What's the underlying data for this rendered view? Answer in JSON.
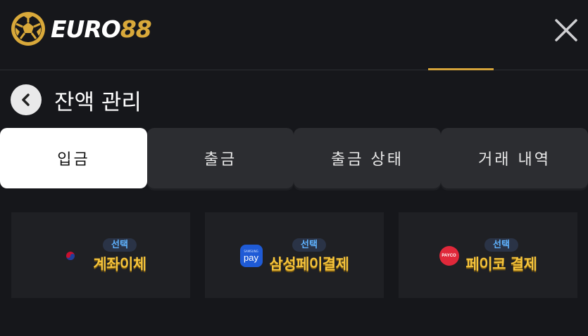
{
  "header": {
    "logo_text": "EURO",
    "logo_accent": "88",
    "close_label": "×"
  },
  "page": {
    "title": "잔액 관리"
  },
  "tabs": [
    {
      "label": "입금",
      "active": true
    },
    {
      "label": "출금",
      "active": false
    },
    {
      "label": "출금 상태",
      "active": false
    },
    {
      "label": "거래 내역",
      "active": false
    }
  ],
  "methods": [
    {
      "badge": "선택",
      "label": "계좌이체",
      "icon": "korea-flag-icon"
    },
    {
      "badge": "선택",
      "label": "삼성페이결제",
      "icon": "samsung-pay-icon",
      "icon_small_text": "SAMSUNG",
      "icon_text": "pay"
    },
    {
      "badge": "선택",
      "label": "페이코 결제",
      "icon": "payco-icon",
      "icon_text": "PAYCO"
    }
  ],
  "colors": {
    "background": "#16171b",
    "accent_gold": "#d4a33a",
    "tab_active_bg": "#ffffff",
    "tab_bg": "#2c2d31",
    "method_label": "#f6c43b",
    "badge_text": "#5fb2ff"
  }
}
